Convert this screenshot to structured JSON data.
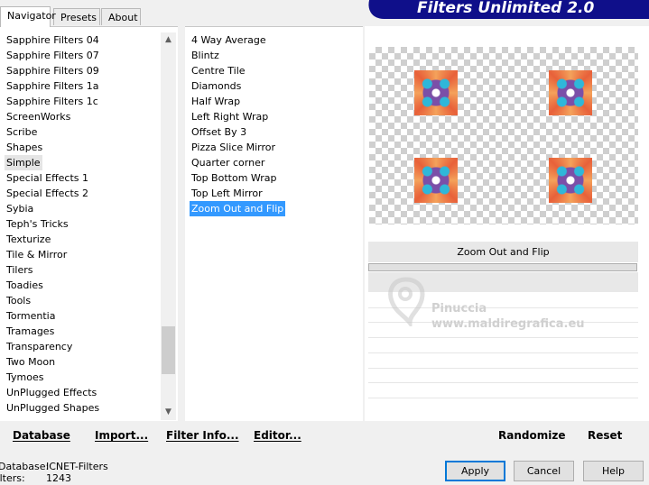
{
  "tabs": [
    "Navigator",
    "Presets",
    "About"
  ],
  "banner": "Filters Unlimited 2.0",
  "categories": {
    "items": [
      "Sapphire Filters 04",
      "Sapphire Filters 07",
      "Sapphire Filters 09",
      "Sapphire Filters 1a",
      "Sapphire Filters 1c",
      "ScreenWorks",
      "Scribe",
      "Shapes",
      "Simple",
      "Special Effects 1",
      "Special Effects 2",
      "Sybia",
      "Teph's Tricks",
      "Texturize",
      "Tile & Mirror",
      "Tilers",
      "Toadies",
      "Tools",
      "Tormentia",
      "Tramages",
      "Transparency",
      "Two Moon",
      "Tymoes",
      "UnPlugged Effects",
      "UnPlugged Shapes"
    ],
    "highlighted": "Simple"
  },
  "filters": {
    "items": [
      "4 Way Average",
      "Blintz",
      "Centre Tile",
      "Diamonds",
      "Half Wrap",
      "Left Right Wrap",
      "Offset By 3",
      "Pizza Slice Mirror",
      "Quarter corner",
      "Top Bottom Wrap",
      "Top Left Mirror",
      "Zoom Out and Flip"
    ],
    "selected": "Zoom Out and Flip"
  },
  "params": {
    "filter_name": "Zoom Out and Flip"
  },
  "watermark": {
    "line1": "Pinuccia",
    "line2": "www.maldiregrafica.eu"
  },
  "commands": {
    "database": "Database",
    "import": "Import...",
    "filter_info": "Filter Info...",
    "editor": "Editor...",
    "randomize": "Randomize",
    "reset": "Reset"
  },
  "info": {
    "database_label": "Database:",
    "database_value": "ICNET-Filters",
    "filters_label": "Filters:",
    "filters_value": "1243"
  },
  "buttons": {
    "apply": "Apply",
    "cancel": "Cancel",
    "help": "Help"
  },
  "colors": {
    "selection": "#3399ff",
    "banner": "#0f0f8a",
    "default_button_border": "#0078d7"
  }
}
